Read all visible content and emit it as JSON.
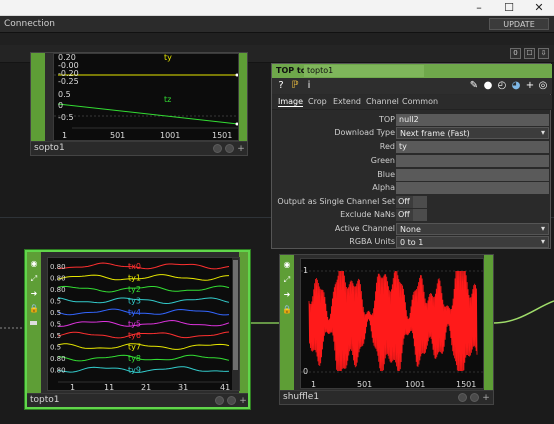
{
  "window": {
    "minimize": "–",
    "maximize": "☐",
    "close": "✕"
  },
  "topbar": {
    "connection_label": "Connection",
    "update_label": "UPDATE"
  },
  "toolbar2": {
    "counter": "0",
    "btn2": "☐",
    "btn3": "⇩"
  },
  "panel": {
    "type_label": "TOP to",
    "node_name": "topto1",
    "tabs": [
      "Image",
      "Crop",
      "Extend",
      "Channel",
      "Common"
    ],
    "params": [
      {
        "label": "TOP",
        "value": "null2"
      },
      {
        "label": "Download Type",
        "value": "Next frame (Fast)"
      },
      {
        "label": "Red",
        "value": "ty"
      },
      {
        "label": "Green",
        "value": ""
      },
      {
        "label": "Blue",
        "value": ""
      },
      {
        "label": "Alpha",
        "value": ""
      },
      {
        "label": "Output as Single Channel Set",
        "value": "Off"
      },
      {
        "label": "Exclude NaNs",
        "value": "Off"
      },
      {
        "label": "Active Channel",
        "value": "None"
      },
      {
        "label": "RGBA Units",
        "value": "0 to 1"
      }
    ]
  },
  "nodes": {
    "sopto": {
      "name": "sopto1",
      "y_ticks": [
        "0.20",
        "-0.00",
        "-0.20",
        "-0.25",
        "0.5",
        "0",
        "-0.5"
      ],
      "x_ticks": [
        "1",
        "501",
        "1001",
        "1501"
      ],
      "series": [
        "ty",
        "tz"
      ]
    },
    "topto": {
      "name": "topto1",
      "x_ticks": [
        "1",
        "11",
        "21",
        "31",
        "41"
      ],
      "series_labels": [
        "tx0",
        "ty1",
        "ty2",
        "ty3",
        "ty4",
        "ty5",
        "ty6",
        "ty7",
        "ty8",
        "ty9"
      ],
      "left_ticks": [
        "0.80",
        "0.80",
        "0.80",
        "0.5",
        "0.5",
        "0.5",
        "0.5",
        "0.5",
        "0.80",
        "0.80"
      ]
    },
    "shuffle": {
      "name": "shuffle1",
      "y_ticks": [
        "1",
        "0"
      ],
      "x_ticks": [
        "1",
        "501",
        "1001",
        "1501"
      ]
    }
  },
  "colors": {
    "node_green": "#5e9e36",
    "selected_border": "#61d64b",
    "shuffle_signal": "#ff1a1a"
  }
}
